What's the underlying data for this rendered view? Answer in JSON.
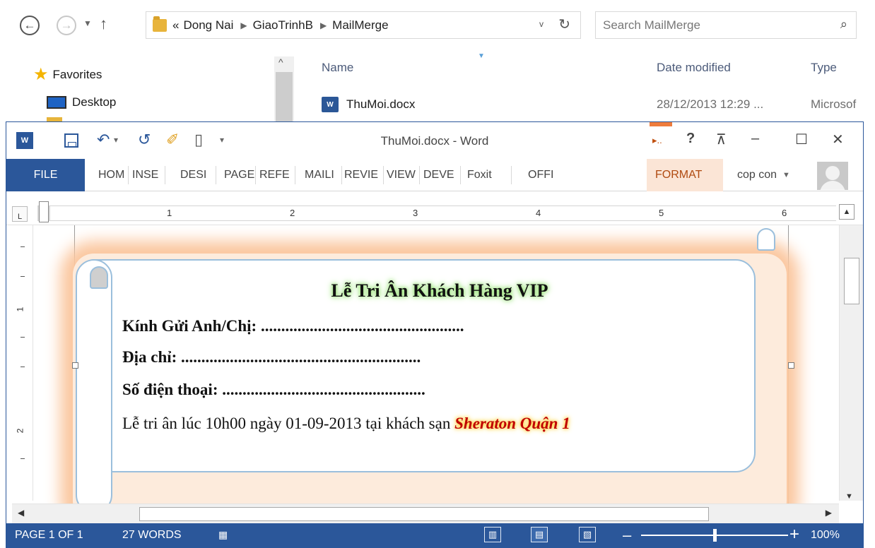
{
  "explorer": {
    "breadcrumb": {
      "prefix": "«",
      "items": [
        "Dong Nai",
        "GiaoTrinhB",
        "MailMerge"
      ]
    },
    "search_placeholder": "Search MailMerge",
    "nav": {
      "favorites": "Favorites",
      "desktop": "Desktop"
    },
    "columns": {
      "name": "Name",
      "date_modified": "Date modified",
      "type": "Type"
    },
    "file": {
      "name": "ThuMoi.docx",
      "date": "28/12/2013 12:29 ...",
      "type": "Microsof"
    }
  },
  "word": {
    "title": "ThuMoi.docx - Word",
    "qat": {
      "undo_dropdown": "▾",
      "customize": "▾"
    },
    "window_controls": {
      "help": "?",
      "minimize": "–",
      "maximize": "☐",
      "close": "✕",
      "collapsed_tab": "▸.."
    },
    "tabs": [
      "FILE",
      "HOM",
      "INSE",
      "DESI",
      "PAGE",
      "REFE",
      "MAILI",
      "REVIE",
      "VIEW",
      "DEVE",
      "Foxit",
      "OFFI",
      "FORMAT"
    ],
    "user": "cop con",
    "ruler_numbers": [
      "1",
      "2",
      "3",
      "4",
      "5",
      "6"
    ],
    "vruler_numbers": [
      "1",
      "2"
    ],
    "document": {
      "heading": "Lễ Tri Ân Khách Hàng VIP",
      "field1": "Kính Gửi Anh/Chị: ..................................................",
      "field2": "Địa chỉ: ...........................................................",
      "field3": "Số điện thoại: ..................................................",
      "invite_text": "Lễ tri ân lúc 10h00 ngày 01-09-2013 tại khách sạn ",
      "hotel": "Sheraton Quận 1"
    },
    "status": {
      "page": "PAGE 1 OF 1",
      "words": "27 WORDS",
      "zoom": "100%",
      "zoom_level_percent": 100
    }
  }
}
